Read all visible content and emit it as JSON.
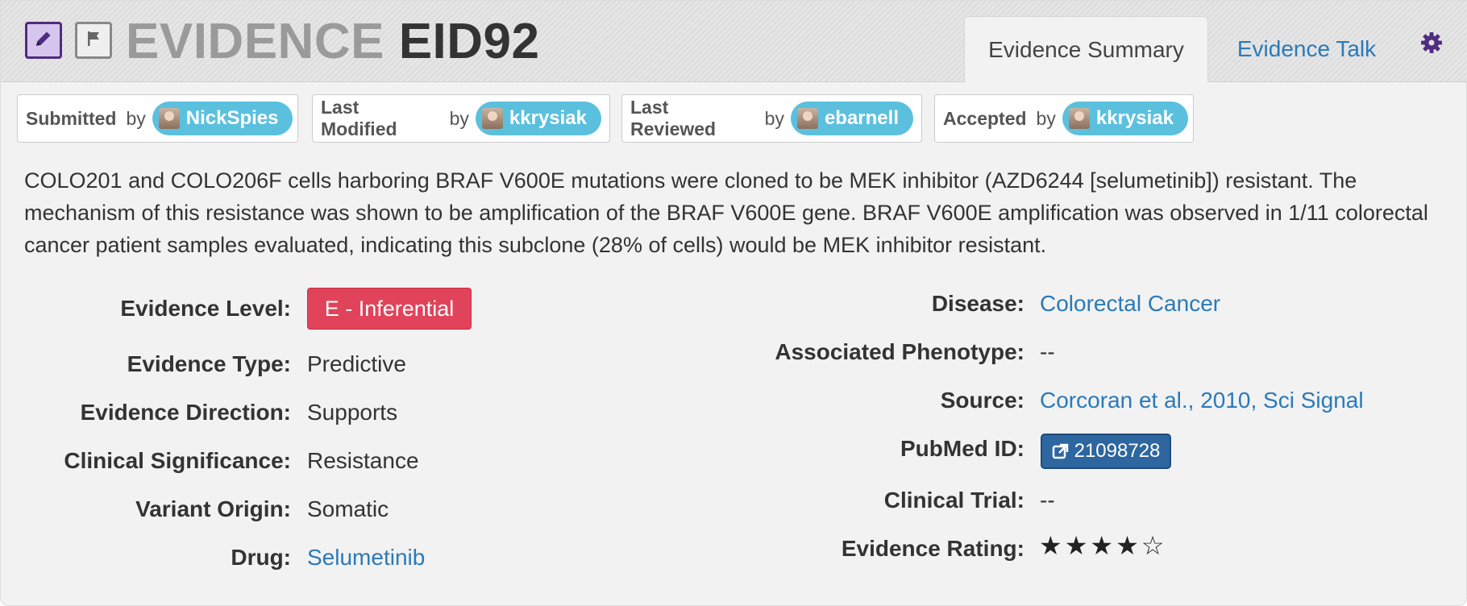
{
  "header": {
    "title_prefix": "EVIDENCE",
    "title_id": "EID92",
    "tabs": [
      {
        "label": "Evidence Summary",
        "active": true
      },
      {
        "label": "Evidence Talk",
        "active": false
      }
    ],
    "icons": {
      "edit": "pencil-icon",
      "flag": "flag-icon",
      "settings": "gear-icon"
    }
  },
  "attribution": [
    {
      "label": "Submitted",
      "by": "by",
      "user": "NickSpies"
    },
    {
      "label": "Last Modified",
      "by": "by",
      "user": "kkrysiak"
    },
    {
      "label": "Last Reviewed",
      "by": "by",
      "user": "ebarnell"
    },
    {
      "label": "Accepted",
      "by": "by",
      "user": "kkrysiak"
    }
  ],
  "description": "COLO201 and COLO206F cells harboring BRAF V600E mutations were cloned to be MEK inhibitor (AZD6244 [selumetinib]) resistant. The mechanism of this resistance was shown to be amplification of the BRAF V600E gene. BRAF V600E amplification was observed in 1/11 colorectal cancer patient samples evaluated, indicating this subclone (28% of cells) would be MEK inhibitor resistant.",
  "left_fields": {
    "evidence_level": {
      "label": "Evidence Level:",
      "value": "E - Inferential"
    },
    "evidence_type": {
      "label": "Evidence Type:",
      "value": "Predictive"
    },
    "evidence_direction": {
      "label": "Evidence Direction:",
      "value": "Supports"
    },
    "clinical_significance": {
      "label": "Clinical Significance:",
      "value": "Resistance"
    },
    "variant_origin": {
      "label": "Variant Origin:",
      "value": "Somatic"
    },
    "drug": {
      "label": "Drug:",
      "value": "Selumetinib"
    }
  },
  "right_fields": {
    "disease": {
      "label": "Disease:",
      "value": "Colorectal Cancer"
    },
    "associated_phenotype": {
      "label": "Associated Phenotype:",
      "value": "--"
    },
    "source": {
      "label": "Source:",
      "value": "Corcoran et al., 2010, Sci Signal"
    },
    "pubmed_id": {
      "label": "PubMed ID:",
      "value": "21098728"
    },
    "clinical_trial": {
      "label": "Clinical Trial:",
      "value": "--"
    },
    "evidence_rating": {
      "label": "Evidence Rating:",
      "value": 4,
      "max": 5,
      "stars": "★★★★☆"
    }
  },
  "colors": {
    "accent_purple": "#4f2d7f",
    "user_badge": "#5bc0de",
    "level_badge": "#e0435a",
    "link": "#2a7ab8",
    "pubmed_button": "#2e66a0"
  }
}
